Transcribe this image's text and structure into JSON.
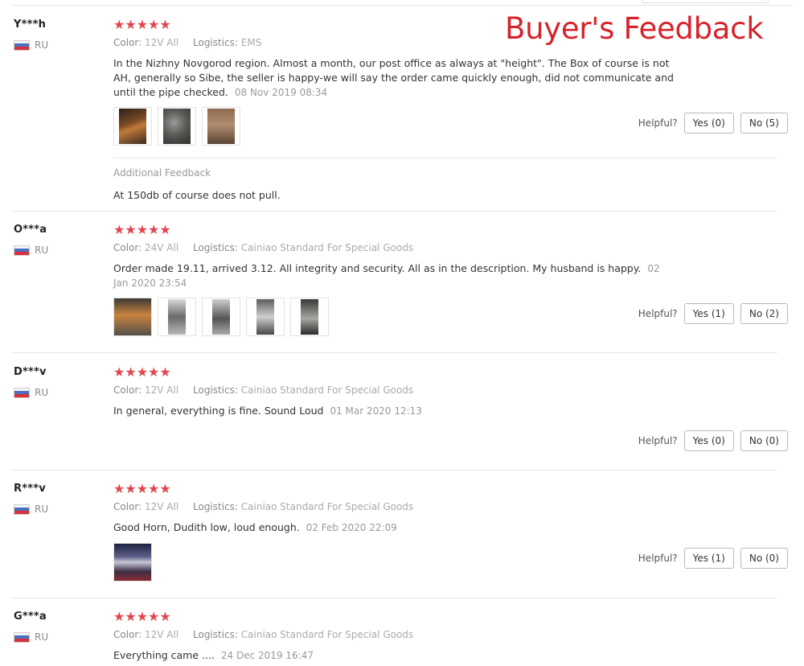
{
  "banner": "Buyer's Feedback",
  "labels": {
    "color": "Color:",
    "logistics": "Logistics:",
    "helpful": "Helpful?"
  },
  "colors": {
    "star": "#e0464e",
    "banner": "#d6232b"
  },
  "reviews": [
    {
      "name": "Y***h",
      "country": "RU",
      "stars": "★★★★★",
      "color": "12V All",
      "logistics": "EMS",
      "text": "In the Nizhny Novgorod region. Almost a month, our post office as always at \"height\". The Box of course is not AH, generally so Sibe, the seller is happy-we will say the order came quickly enough, did not communicate and until the pipe checked.",
      "date": "08 Nov 2019 08:34",
      "yes": "Yes (0)",
      "no": "No (5)",
      "additional_title": "Additional Feedback",
      "additional_text": "At 150db of course does not pull."
    },
    {
      "name": "O***a",
      "country": "RU",
      "stars": "★★★★★",
      "color": "24V All",
      "logistics": "Cainiao Standard For Special Goods",
      "text": "Order made 19.11, arrived 3.12. All integrity and security. All as in the description. My husband is happy.",
      "date": "02 Jan 2020 23:54",
      "yes": "Yes (1)",
      "no": "No (2)"
    },
    {
      "name": "D***v",
      "country": "RU",
      "stars": "★★★★★",
      "color": "12V All",
      "logistics": "Cainiao Standard For Special Goods",
      "text": "In general, everything is fine. Sound Loud",
      "date": "01 Mar 2020 12:13",
      "yes": "Yes (0)",
      "no": "No (0)"
    },
    {
      "name": "R***v",
      "country": "RU",
      "stars": "★★★★★",
      "color": "12V All",
      "logistics": "Cainiao Standard For Special Goods",
      "text": "Good Horn, Dudith low, loud enough.",
      "date": "02 Feb 2020 22:09",
      "yes": "Yes (1)",
      "no": "No (0)"
    },
    {
      "name": "G***a",
      "country": "RU",
      "stars": "★★★★★",
      "color": "12V All",
      "logistics": "Cainiao Standard For Special Goods",
      "text": "Everything came ....",
      "date": "24 Dec 2019 16:47"
    }
  ]
}
